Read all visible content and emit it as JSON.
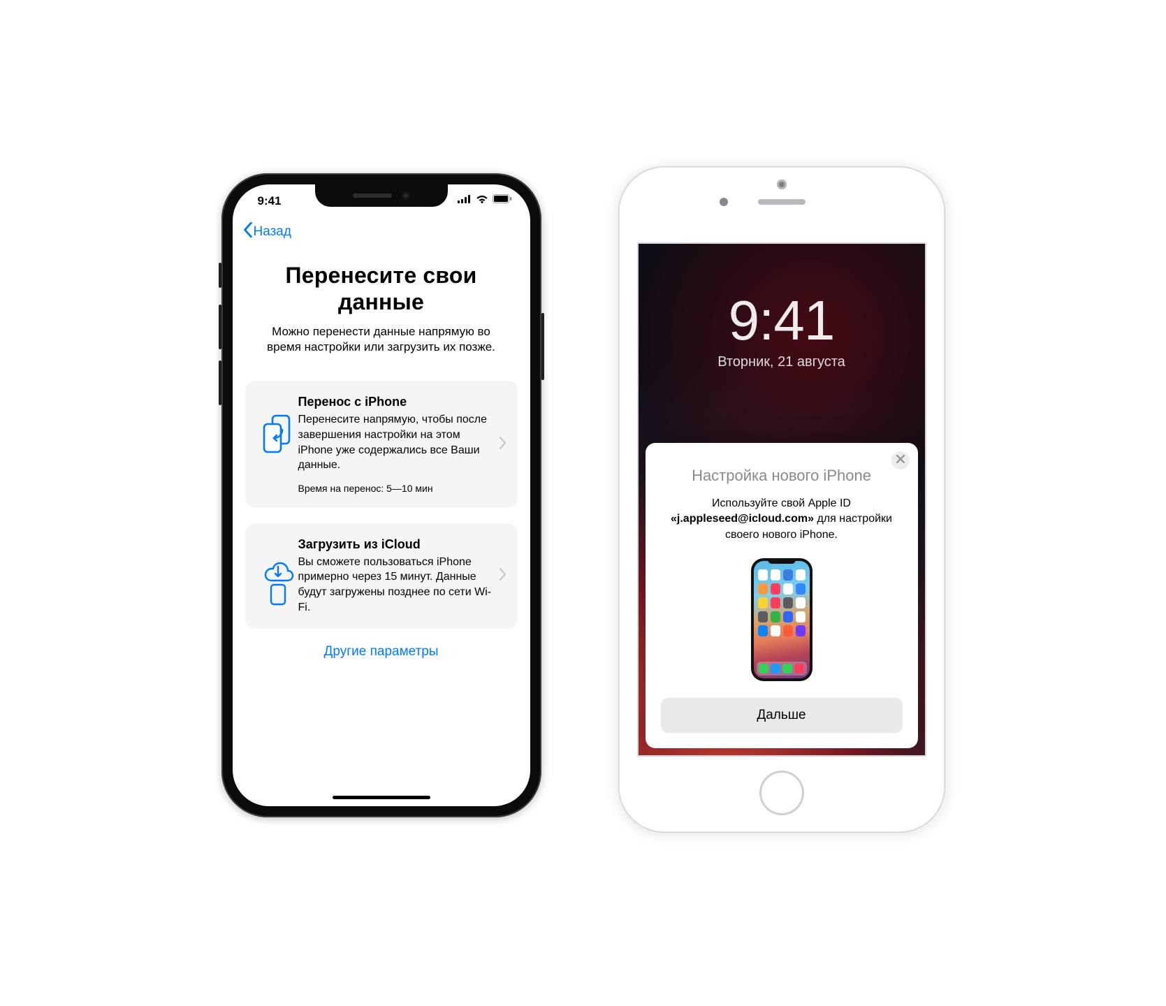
{
  "colors": {
    "accent": "#007aff"
  },
  "left": {
    "status": {
      "time": "9:41"
    },
    "nav": {
      "back_label": "Назад"
    },
    "title": "Перенесите свои данные",
    "subtitle": "Можно перенести данные напрямую во время настройки или загрузить их позже.",
    "options": [
      {
        "title": "Перенос с iPhone",
        "desc": "Перенесите напрямую, чтобы после завершения настройки на этом iPhone уже содержались все Ваши данные.",
        "meta": "Время на перенос: 5—10 мин"
      },
      {
        "title": "Загрузить из iCloud",
        "desc": "Вы сможете пользоваться iPhone примерно через 15 минут. Данные будут загружены позднее по сети Wi-Fi."
      }
    ],
    "other_label": "Другие параметры"
  },
  "right": {
    "lock": {
      "time": "9:41",
      "date": "Вторник, 21 августа"
    },
    "sheet": {
      "title": "Настройка нового iPhone",
      "body_prefix": "Используйте свой Apple ID ",
      "body_id_open": "«",
      "body_id": "j.appleseed@icloud.com",
      "body_id_close": "»",
      "body_suffix": " для настройки своего нового iPhone.",
      "continue_label": "Дальше"
    }
  }
}
